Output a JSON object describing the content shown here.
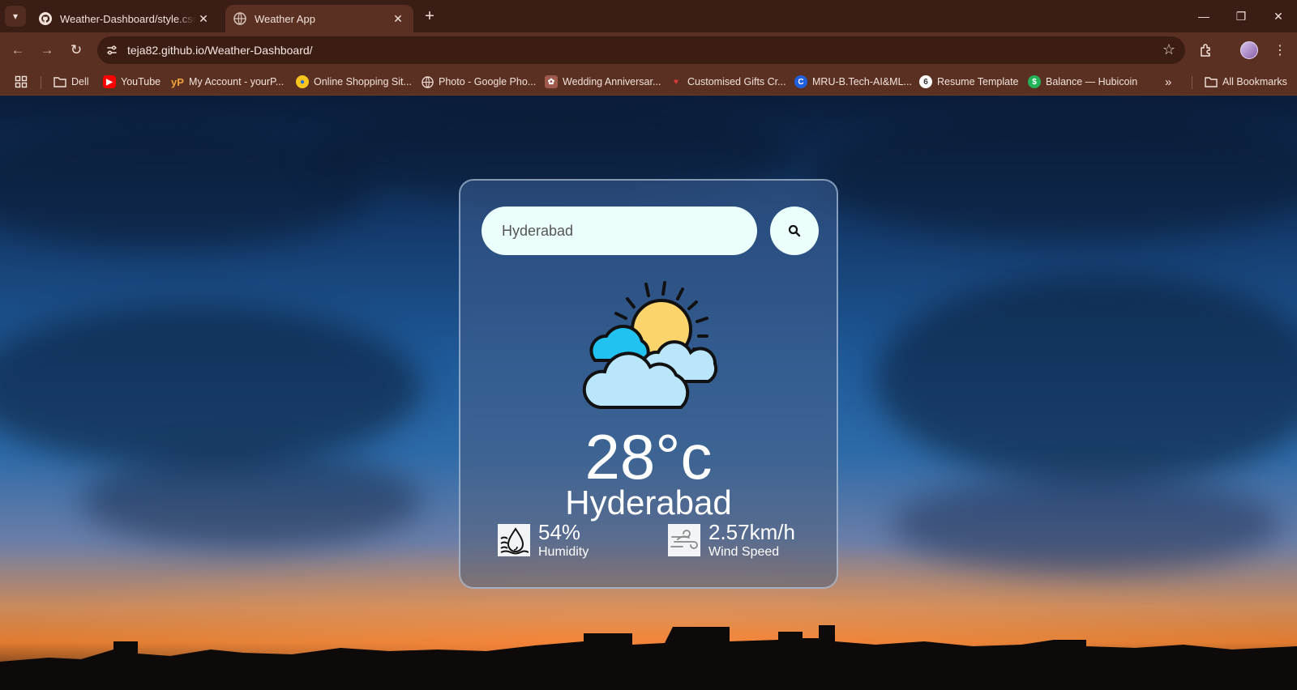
{
  "browser": {
    "tabs": [
      {
        "title": "Weather-Dashboard/style.css at",
        "icon": "github-icon"
      },
      {
        "title": "Weather App",
        "icon": "globe-icon"
      }
    ],
    "url": "teja82.github.io/Weather-Dashboard/",
    "bookmarks": [
      {
        "label": "Dell",
        "icon": "folder-icon"
      },
      {
        "label": "YouTube",
        "icon": "youtube-icon"
      },
      {
        "label": "My Account - yourP...",
        "icon": "yourpoint-icon"
      },
      {
        "label": "Online Shopping Sit...",
        "icon": "shopping-icon"
      },
      {
        "label": "Photo - Google Pho...",
        "icon": "globe-icon"
      },
      {
        "label": "Wedding Anniversar...",
        "icon": "gift-icon"
      },
      {
        "label": "Customised Gifts Cr...",
        "icon": "gift-icon"
      },
      {
        "label": "MRU-B.Tech-AI&ML...",
        "icon": "c-icon"
      },
      {
        "label": "Resume Template",
        "icon": "resume-icon"
      },
      {
        "label": "Balance — Hubicoin",
        "icon": "hubicoin-icon"
      }
    ],
    "all_bookmarks": "All Bookmarks"
  },
  "weather": {
    "search_value": "Hyderabad",
    "condition_icon": "partly-cloudy-icon",
    "temperature": "28°c",
    "city": "Hyderabad",
    "humidity": {
      "value": "54%",
      "label": "Humidity",
      "icon": "humidity-icon"
    },
    "wind": {
      "value": "2.57km/h",
      "label": "Wind Speed",
      "icon": "wind-icon"
    }
  }
}
